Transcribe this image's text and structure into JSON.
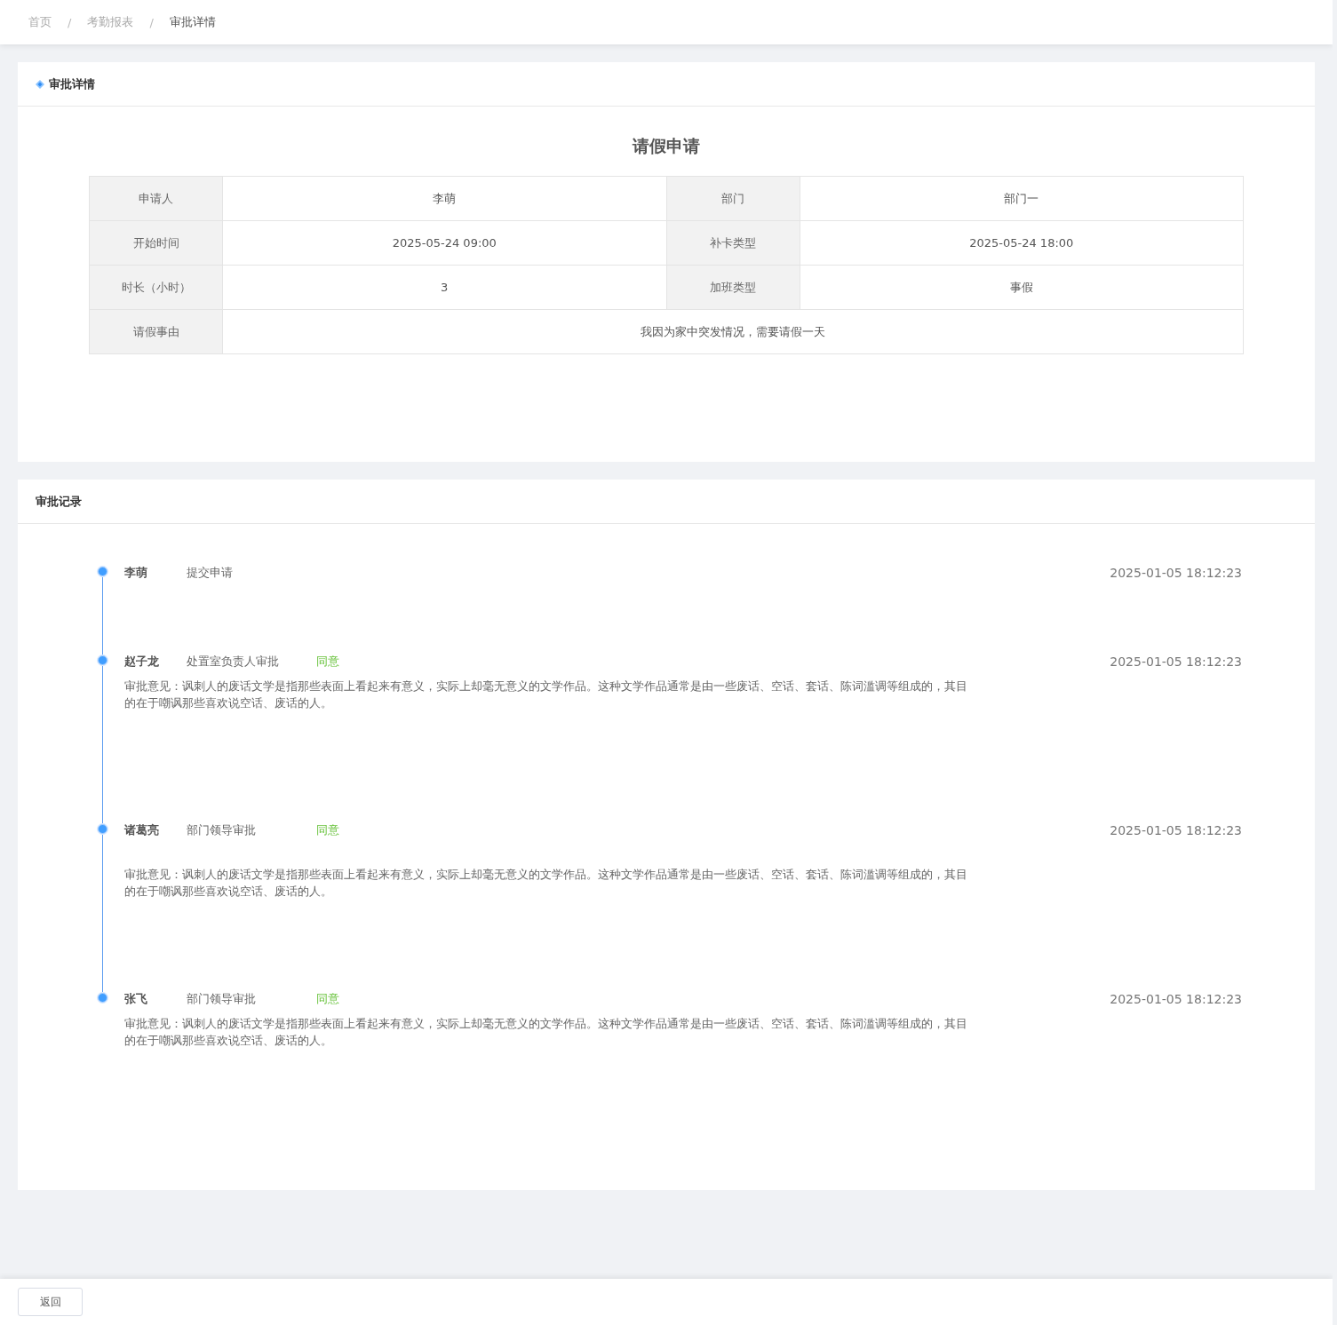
{
  "breadcrumb": {
    "separator": "/",
    "items": [
      "首页",
      "考勤报表",
      "审批详情"
    ]
  },
  "detail_card": {
    "title": "审批详情",
    "form_title": "请假申请",
    "rows": [
      [
        {
          "label": "申请人",
          "value": "李萌"
        },
        {
          "label": "部门",
          "value": "部门一"
        }
      ],
      [
        {
          "label": "开始时间",
          "value": "2025-05-24 09:00"
        },
        {
          "label": "补卡类型",
          "value": "2025-05-24 18:00"
        }
      ],
      [
        {
          "label": "时长（小时）",
          "value": "3"
        },
        {
          "label": "加班类型",
          "value": "事假"
        }
      ],
      [
        {
          "label": "请假事由",
          "value": "我因为家中突发情况，需要请假一天"
        }
      ]
    ]
  },
  "record_card": {
    "title": "审批记录",
    "items": [
      {
        "name": "李萌",
        "step": "提交申请",
        "time": "2025-01-05  18:12:23"
      },
      {
        "name": "赵子龙",
        "step": "处置室负责人审批",
        "result": "同意",
        "time": "2025-01-05  18:12:23",
        "comment": "审批意见：讽刺人的废话文学是指那些表面上看起来有意义，实际上却毫无意义的文学作品。这种文学作品通常是由一些废话、空话、套话、陈词滥调等组成的，其目的在于嘲讽那些喜欢说空话、废话的人。"
      },
      {
        "name": "诸葛亮",
        "step": "部门领导审批",
        "result": "同意",
        "time": "2025-01-05  18:12:23",
        "comment": "审批意见：讽刺人的废话文学是指那些表面上看起来有意义，实际上却毫无意义的文学作品。这种文学作品通常是由一些废话、空话、套话、陈词滥调等组成的，其目的在于嘲讽那些喜欢说空话、废话的人。"
      },
      {
        "name": "张飞",
        "step": "部门领导审批",
        "result": "同意",
        "time": "2025-01-05  18:12:23",
        "comment": "审批意见：讽刺人的废话文学是指那些表面上看起来有意义，实际上却毫无意义的文学作品。这种文学作品通常是由一些废话、空话、套话、陈词滥调等组成的，其目的在于嘲讽那些喜欢说空话、废话的人。"
      }
    ]
  },
  "footer": {
    "back_button": "返回"
  }
}
